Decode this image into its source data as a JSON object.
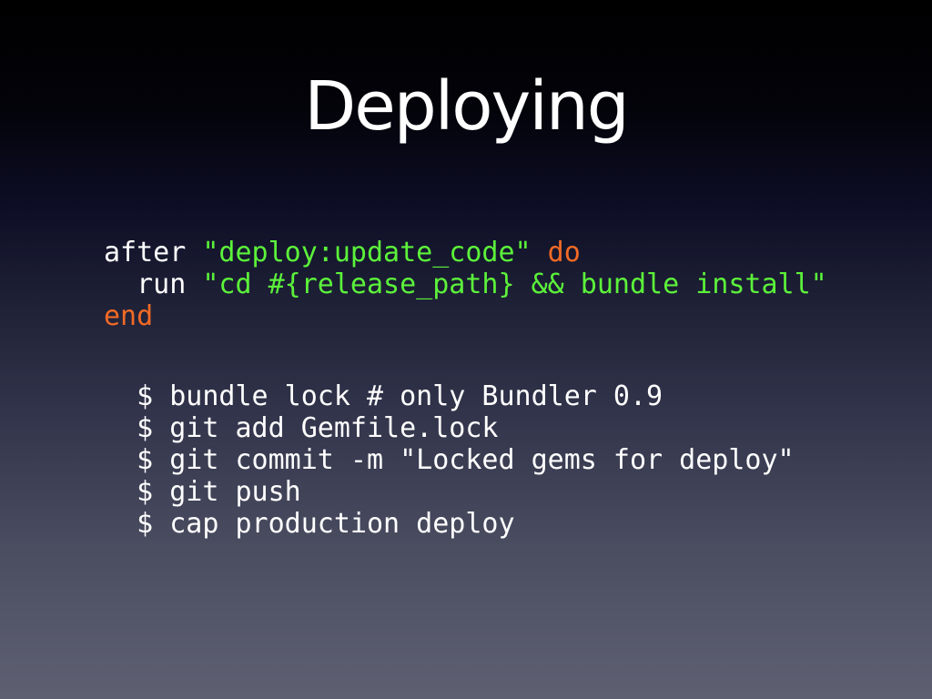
{
  "colors": {
    "plain": "#ffffff",
    "string": "#5cf23a",
    "keyword": "#f26a25"
  },
  "slide": {
    "title": "Deploying"
  },
  "ruby_code": {
    "line1": {
      "word_after": "after",
      "str_event": "\"deploy:update_code\"",
      "kw_do": "do"
    },
    "line2": {
      "word_run": "run",
      "str_command": "\"cd #{release_path} && bundle install\""
    },
    "line3": {
      "kw_end": "end"
    }
  },
  "shell_commands": [
    "$ bundle lock # only Bundler 0.9",
    "$ git add Gemfile.lock",
    "$ git commit -m \"Locked gems for deploy\"",
    "$ git push",
    "$ cap production deploy"
  ]
}
